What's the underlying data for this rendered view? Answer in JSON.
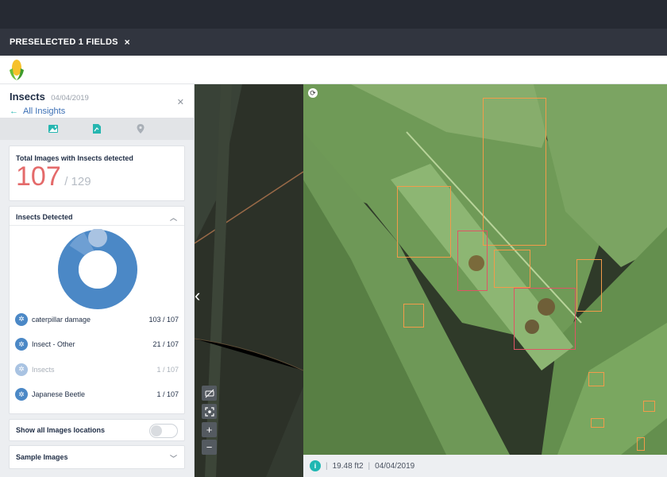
{
  "topbar": {
    "preselected_label": "PRESELECTED 1 FIELDS",
    "close_glyph": "×"
  },
  "colors": {
    "accent": "#26b6b0",
    "donut_main": "#4b88c6",
    "box_orange": "#f29b4a",
    "box_red": "#e05465"
  },
  "panel": {
    "title": "Insects",
    "date": "04/04/2019",
    "back_link": "All Insights",
    "tabs": [
      "image-map-icon",
      "report-icon",
      "location-pin-icon"
    ],
    "total": {
      "label": "Total Images with Insects detected",
      "count": "107",
      "of_total": "/ 129"
    },
    "insects_detected": {
      "title": "Insects Detected",
      "items": [
        {
          "name": "caterpillar damage",
          "count": "103 / 107"
        },
        {
          "name": "Insect - Other",
          "count": "21 / 107"
        },
        {
          "name": "Insects",
          "count": "1 / 107"
        },
        {
          "name": "Japanese Beetle",
          "count": "1 / 107"
        }
      ]
    },
    "show_all_label": "Show all Images locations",
    "sample_images_label": "Sample Images"
  },
  "map": {
    "controls": [
      "hide-icon",
      "fit-icon",
      "+",
      "−"
    ]
  },
  "photo_footer": {
    "info_glyph": "i",
    "area": "19.48 ft2",
    "date": "04/04/2019"
  }
}
